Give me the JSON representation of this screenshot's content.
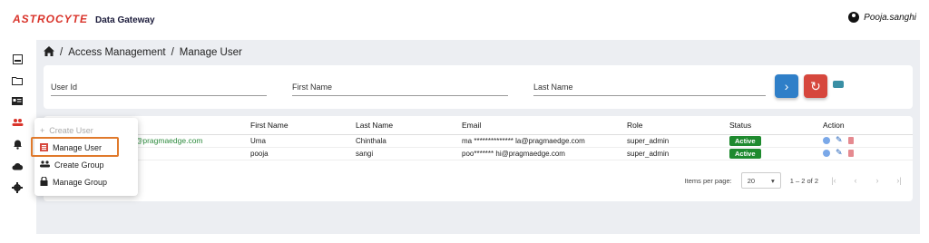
{
  "header": {
    "logo_text": "ASTROCYTE",
    "app_name": "Data Gateway",
    "username": "Pooja.sanghi",
    "logo_color": "#d9342b"
  },
  "sidebar": {
    "icons": [
      "dashboard-icon",
      "folder-icon",
      "id-card-icon",
      "users-icon",
      "bell-icon",
      "cloud-icon",
      "gear-icon"
    ]
  },
  "breadcrumb": {
    "home_icon": "home-icon",
    "items": [
      "Access Management",
      "Manage User"
    ],
    "separator": "/"
  },
  "filters": {
    "user_id_label": "User Id",
    "first_name_label": "First Name",
    "last_name_label": "Last Name"
  },
  "table": {
    "headers": [
      "First Name",
      "Last Name",
      "Email",
      "Role",
      "Status",
      "Action"
    ],
    "rows": [
      {
        "user_id": "a@pragmaedge.com",
        "first_name": "Uma",
        "last_name": "Chinthala",
        "email": "ma ************** la@pragmaedge.com",
        "role": "super_admin",
        "status": "Active"
      },
      {
        "user_id": "",
        "first_name": "pooja",
        "last_name": "sangi",
        "email": "poo******* hi@pragmaedge.com",
        "role": "super_admin",
        "status": "Active"
      }
    ]
  },
  "pagination": {
    "items_per_page_label": "Items per page:",
    "items_per_page_value": "20",
    "range": "1 – 2 of 2"
  },
  "menu": {
    "items": [
      {
        "label": "Create User",
        "icon": "plus-icon",
        "disabled": true
      },
      {
        "label": "Manage User",
        "icon": "manage-user-icon",
        "active": true
      },
      {
        "label": "Create Group",
        "icon": "group-icon"
      },
      {
        "label": "Manage Group",
        "icon": "lock-icon"
      }
    ]
  },
  "colors": {
    "accent_blue": "#2f7fc8",
    "reset_red": "#d6473d",
    "active_badge": "#1e8a2e",
    "highlight_orange": "#e07a2c"
  }
}
